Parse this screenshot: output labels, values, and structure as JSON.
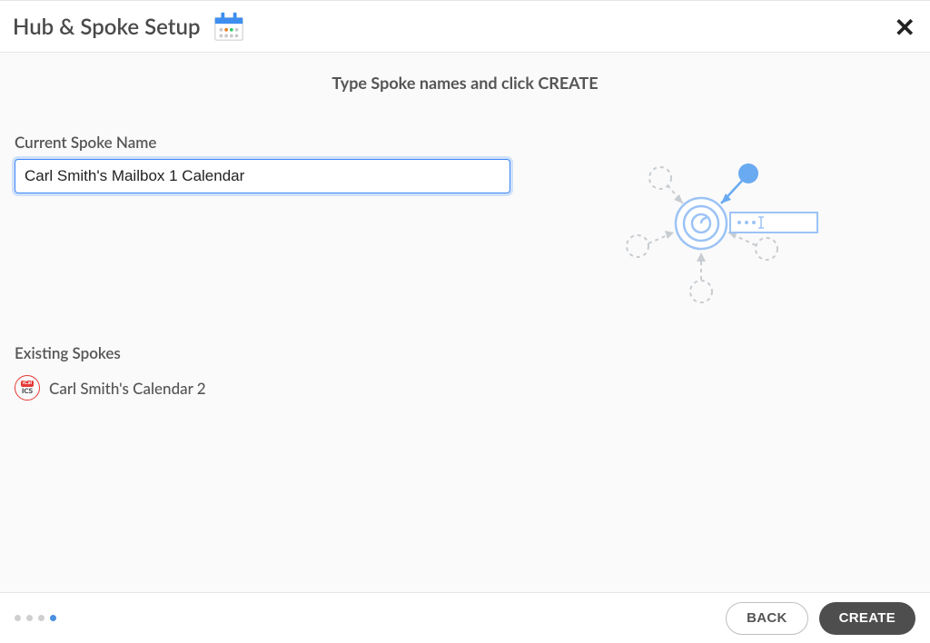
{
  "header": {
    "title": "Hub & Spoke Setup"
  },
  "instruction": "Type Spoke names and click CREATE",
  "form": {
    "current_spoke_label": "Current Spoke Name",
    "current_spoke_value": "Carl Smith's Mailbox 1 Calendar"
  },
  "existing": {
    "title": "Existing Spokes",
    "items": [
      {
        "label": "Carl Smith's Calendar 2",
        "icon": "ics-icon"
      }
    ]
  },
  "footer": {
    "back_label": "BACK",
    "create_label": "CREATE"
  },
  "progress": {
    "total_steps": 4,
    "current_step": 4
  }
}
